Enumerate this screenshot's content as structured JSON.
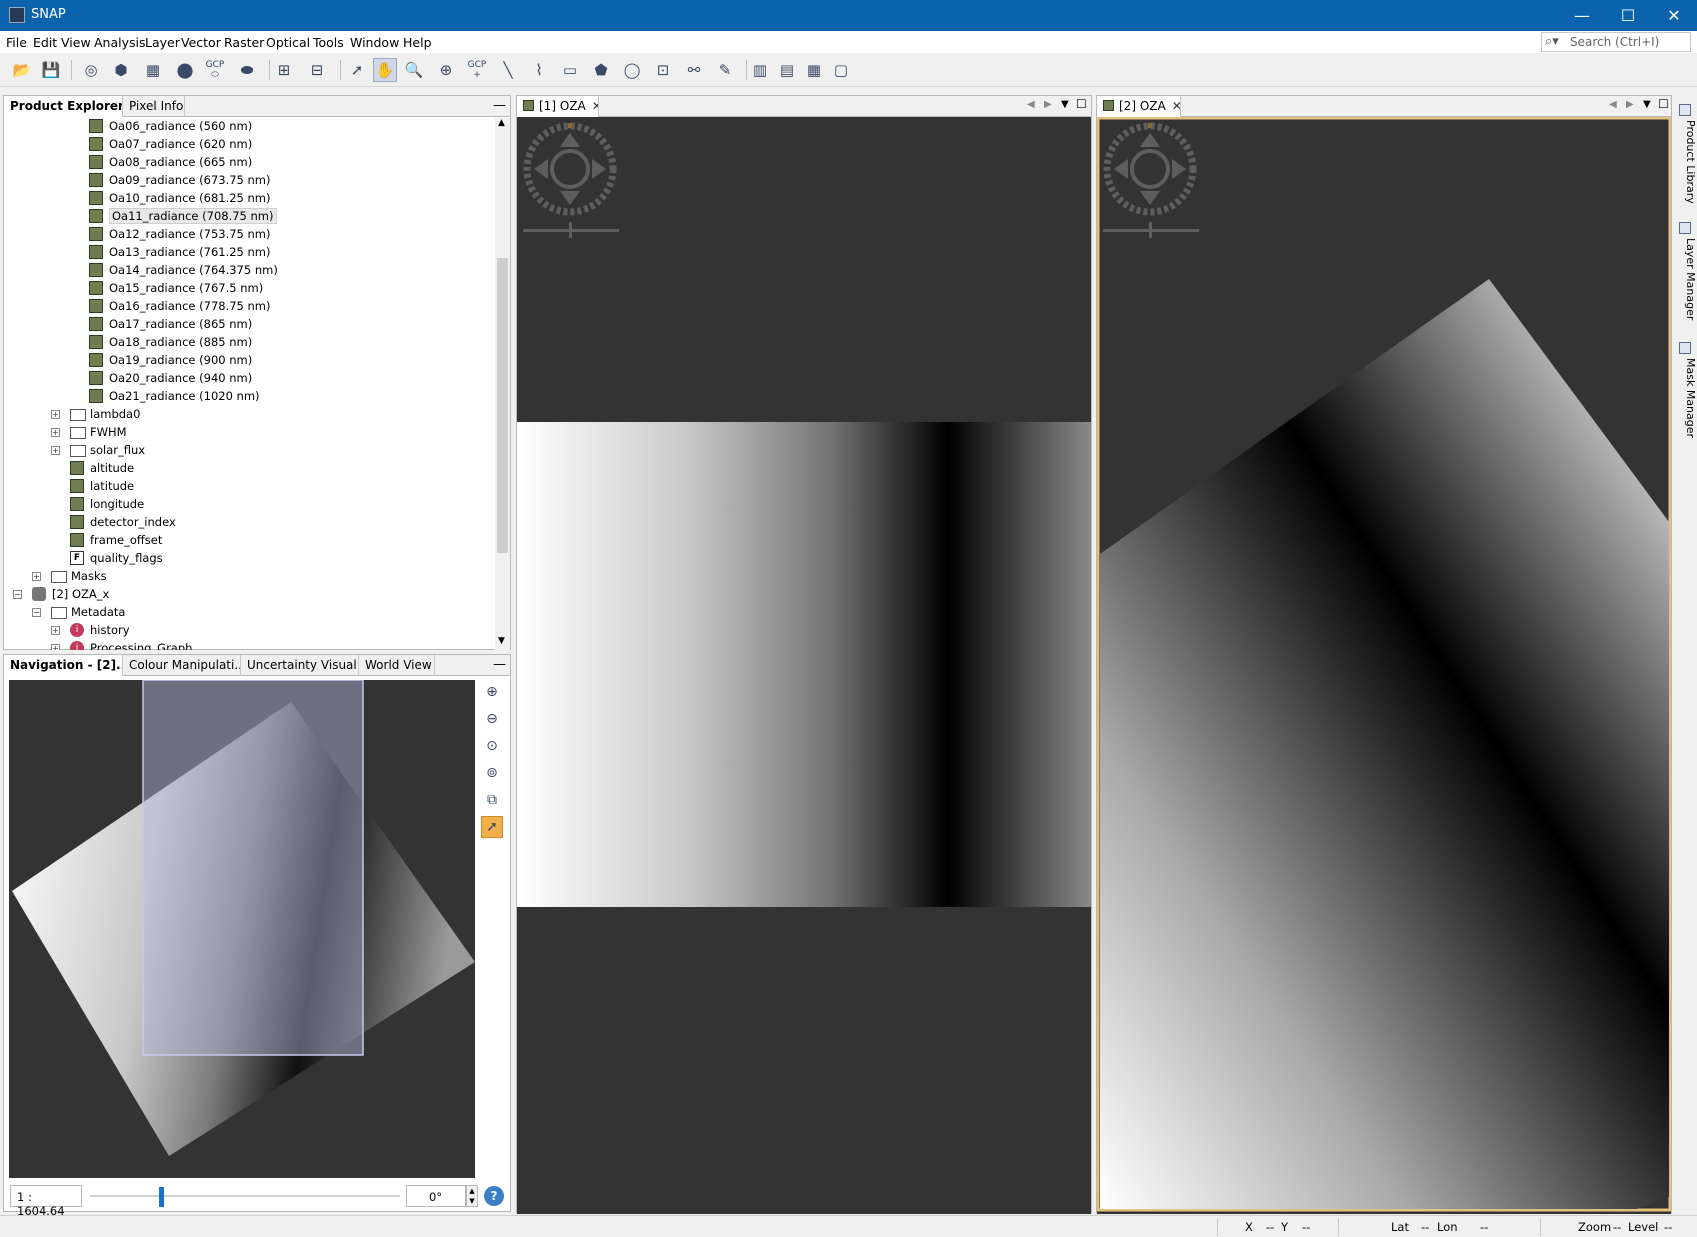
{
  "window": {
    "title": "SNAP",
    "minimize": "—",
    "maximize": "☐",
    "close": "✕"
  },
  "menu": [
    "File",
    "Edit",
    "View",
    "Analysis",
    "Layer",
    "Vector",
    "Raster",
    "Optical",
    "Tools",
    "Window",
    "Help"
  ],
  "search": {
    "placeholder": "Search (Ctrl+I)"
  },
  "toolbar": {
    "gcp_label": "GCP",
    "gcp_label2": "GCP"
  },
  "product_explorer": {
    "tabs": [
      "Product Explorer",
      "Pixel Info"
    ],
    "selected_tab": "Product Explorer",
    "tree": [
      {
        "label": "Oa06_radiance (560 nm)",
        "icon": "band-icon",
        "level": 4
      },
      {
        "label": "Oa07_radiance (620 nm)",
        "icon": "band-icon",
        "level": 4
      },
      {
        "label": "Oa08_radiance (665 nm)",
        "icon": "band-icon",
        "level": 4
      },
      {
        "label": "Oa09_radiance (673.75 nm)",
        "icon": "band-icon",
        "level": 4
      },
      {
        "label": "Oa10_radiance (681.25 nm)",
        "icon": "band-icon",
        "level": 4
      },
      {
        "label": "Oa11_radiance (708.75 nm)",
        "icon": "band-icon",
        "level": 4,
        "selected": true
      },
      {
        "label": "Oa12_radiance (753.75 nm)",
        "icon": "band-icon",
        "level": 4
      },
      {
        "label": "Oa13_radiance (761.25 nm)",
        "icon": "band-icon",
        "level": 4
      },
      {
        "label": "Oa14_radiance (764.375 nm)",
        "icon": "band-icon",
        "level": 4
      },
      {
        "label": "Oa15_radiance (767.5 nm)",
        "icon": "band-icon",
        "level": 4
      },
      {
        "label": "Oa16_radiance (778.75 nm)",
        "icon": "band-icon",
        "level": 4
      },
      {
        "label": "Oa17_radiance (865 nm)",
        "icon": "band-icon",
        "level": 4
      },
      {
        "label": "Oa18_radiance (885 nm)",
        "icon": "band-icon",
        "level": 4
      },
      {
        "label": "Oa19_radiance (900 nm)",
        "icon": "band-icon",
        "level": 4
      },
      {
        "label": "Oa20_radiance (940 nm)",
        "icon": "band-icon",
        "level": 4
      },
      {
        "label": "Oa21_radiance (1020 nm)",
        "icon": "band-icon",
        "level": 4
      },
      {
        "label": "lambda0",
        "icon": "folder-icon",
        "level": 3,
        "expander": "+"
      },
      {
        "label": "FWHM",
        "icon": "folder-icon",
        "level": 3,
        "expander": "+"
      },
      {
        "label": "solar_flux",
        "icon": "folder-icon",
        "level": 3,
        "expander": "+"
      },
      {
        "label": "altitude",
        "icon": "band-icon",
        "level": 3
      },
      {
        "label": "latitude",
        "icon": "band-icon",
        "level": 3
      },
      {
        "label": "longitude",
        "icon": "band-icon",
        "level": 3
      },
      {
        "label": "detector_index",
        "icon": "band-icon",
        "level": 3
      },
      {
        "label": "frame_offset",
        "icon": "band-icon",
        "level": 3
      },
      {
        "label": "quality_flags",
        "icon": "flag-icon",
        "level": 3
      },
      {
        "label": "Masks",
        "icon": "folder-icon",
        "level": 2,
        "expander": "+"
      },
      {
        "label": "[2] OZA_x",
        "icon": "product-icon",
        "level": 1,
        "expander": "−"
      },
      {
        "label": "Metadata",
        "icon": "folder-icon",
        "level": 2,
        "expander": "−"
      },
      {
        "label": "history",
        "icon": "info-icon",
        "level": 3,
        "expander": "+"
      },
      {
        "label": "Processing_Graph",
        "icon": "info-icon",
        "level": 3,
        "expander": "+"
      }
    ]
  },
  "navigation_panel": {
    "tabs": [
      "Navigation - [2]...",
      "Colour Manipulati...",
      "Uncertainty Visual...",
      "World View"
    ],
    "scale": "1 : 1604.64",
    "rotation": "0°",
    "help": "?"
  },
  "views": [
    {
      "tab": "[1] OZA"
    },
    {
      "tab": "[2] OZA"
    }
  ],
  "side_tabs": [
    "Product Library",
    "Layer Manager",
    "Mask Manager"
  ],
  "status": {
    "x_label": "X",
    "x_val": "--",
    "y_label": "Y",
    "y_val": "--",
    "lat_label": "Lat",
    "lat_val": "--",
    "lon_label": "Lon",
    "lon_val": "--",
    "zoom_label": "Zoom",
    "zoom_val": "--",
    "level_label": "Level",
    "level_val": "--"
  },
  "colors": {
    "titlebar": "#0b63ad",
    "view_bg": "#333333",
    "active_border": "#e2c27a"
  }
}
